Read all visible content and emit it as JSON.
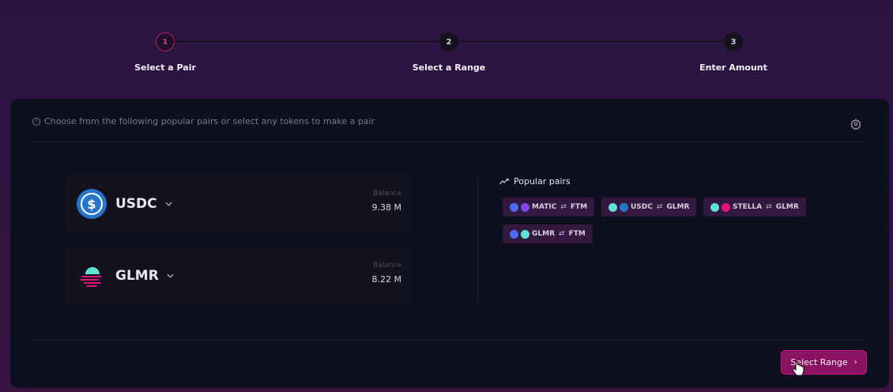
{
  "stepper": {
    "steps": [
      {
        "number": "1",
        "label": "Select a Pair",
        "active": true
      },
      {
        "number": "2",
        "label": "Select a Range",
        "active": false
      },
      {
        "number": "3",
        "label": "Enter Amount",
        "active": false
      }
    ]
  },
  "card": {
    "info_text": "Choose from the following popular pairs or select any tokens to make a pair",
    "tokens": [
      {
        "symbol": "USDC",
        "balance_label": "Balance",
        "balance": "9.38 M",
        "icon": "usdc-icon"
      },
      {
        "symbol": "GLMR",
        "balance_label": "Balance",
        "balance": "8.22 M",
        "icon": "glmr-icon"
      }
    ],
    "popular": {
      "title": "Popular pairs",
      "pairs": [
        {
          "a": "MATIC",
          "b": "FTM"
        },
        {
          "a": "USDC",
          "b": "GLMR"
        },
        {
          "a": "STELLA",
          "b": "GLMR"
        },
        {
          "a": "GLMR",
          "b": "FTM"
        }
      ]
    },
    "primary_button": "Select Range"
  },
  "colors": {
    "accent": "#c4176b",
    "button": "#8a1262",
    "card_bg": "#0e0f1f",
    "pair_bg": "#33193f"
  }
}
